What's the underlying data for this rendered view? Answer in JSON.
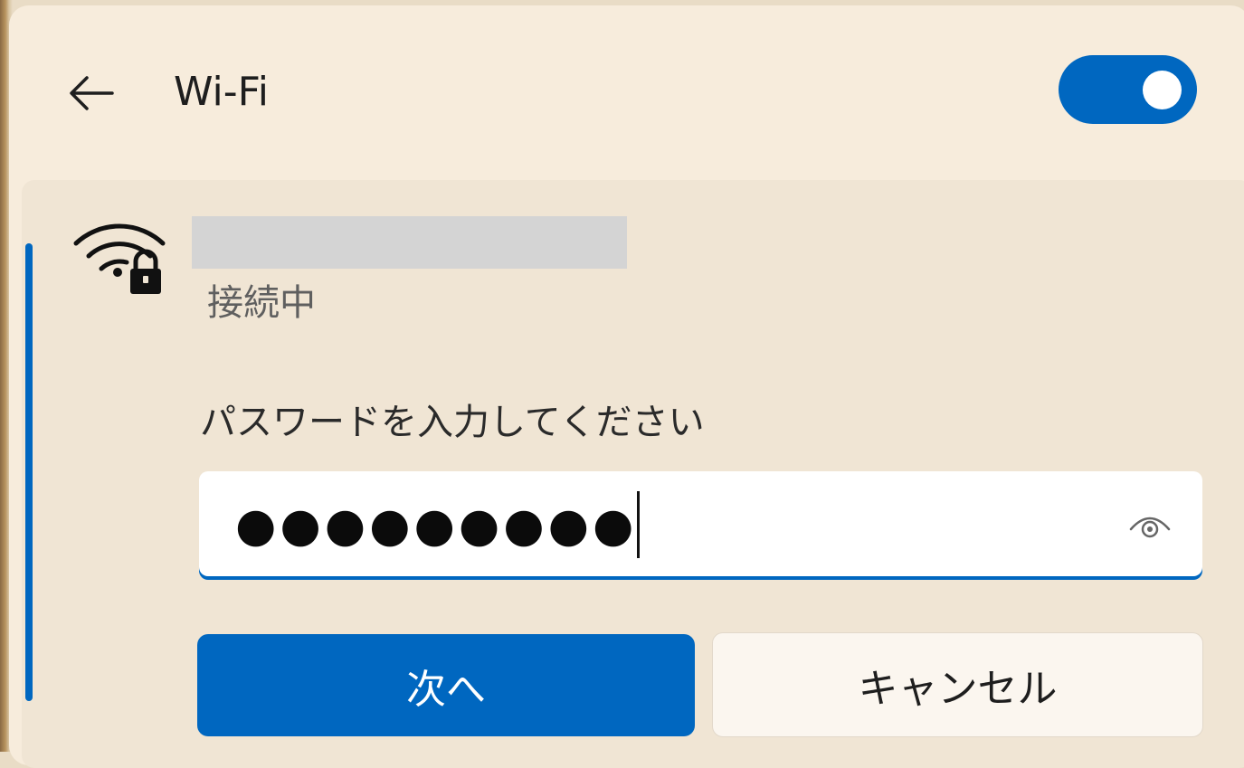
{
  "header": {
    "title": "Wi-Fi",
    "back_icon": "arrow-left-icon",
    "wifi_toggle_on": true
  },
  "network": {
    "ssid": "",
    "status": "接続中",
    "icon": "wifi-secured-icon",
    "password_prompt": "パスワードを入力してください",
    "password_masked": "●●●●●●●●●",
    "reveal_icon": "eye-icon"
  },
  "actions": {
    "next_label": "次へ",
    "cancel_label": "キャンセル"
  },
  "colors": {
    "accent": "#0067c0",
    "panel_background": "#f7ecdc"
  }
}
